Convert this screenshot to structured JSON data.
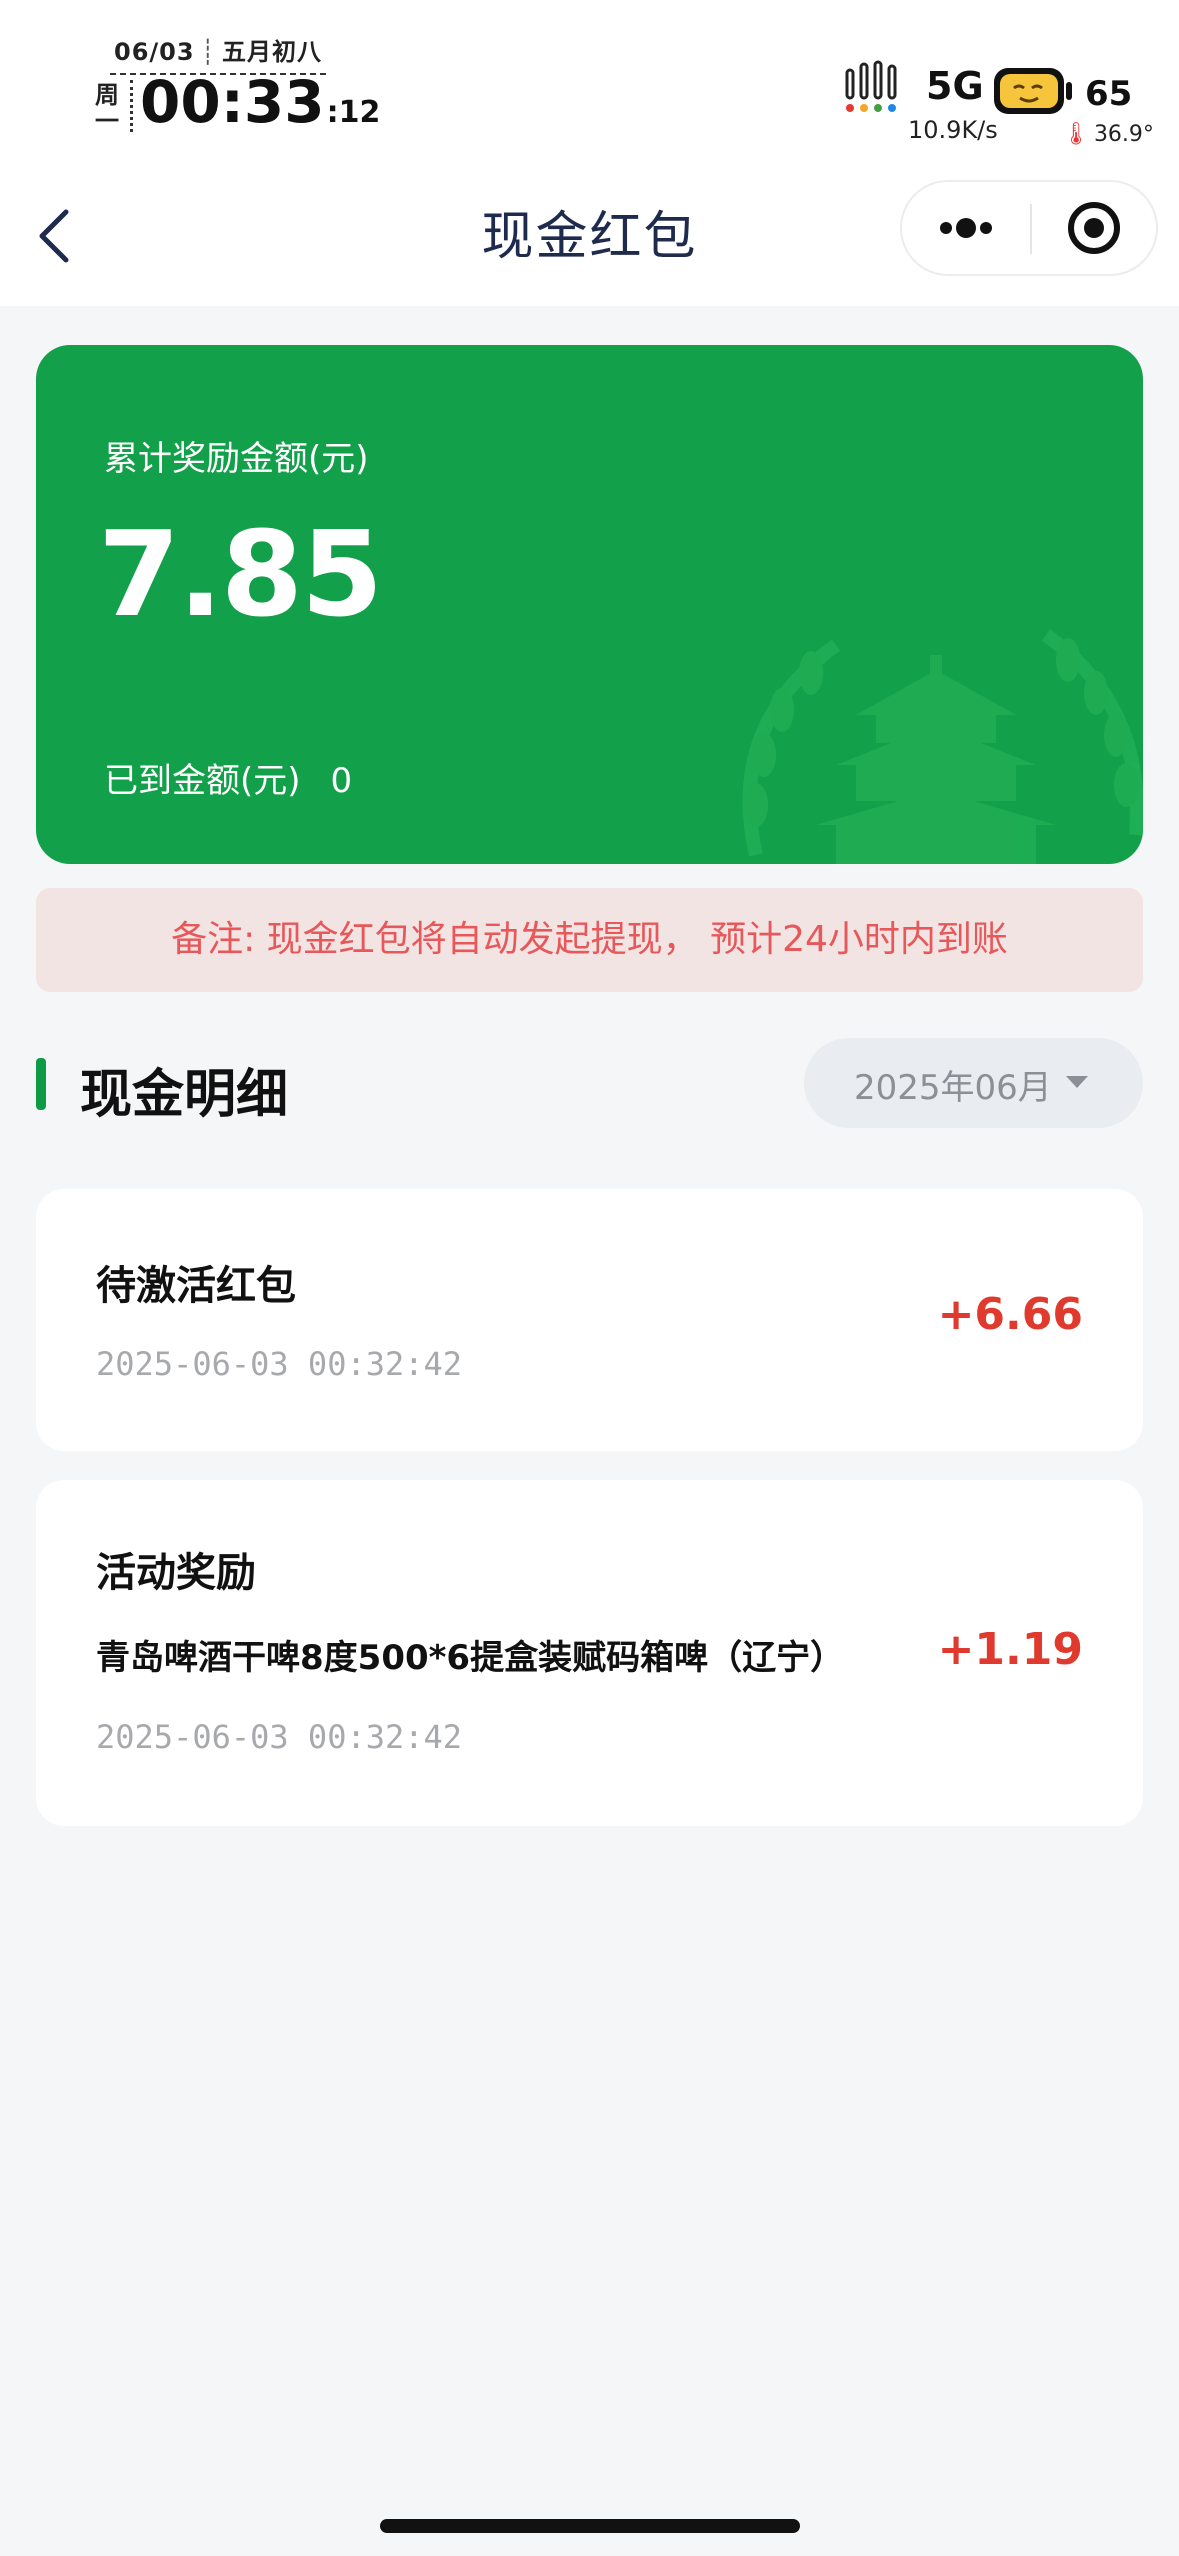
{
  "status_bar": {
    "date": "06/03",
    "lunar": "五月初八",
    "weekday": "周一",
    "time": "00:33",
    "seconds": ":12",
    "network": "5G",
    "speed": "10.9K/s",
    "battery": "65",
    "temperature": "36.9°"
  },
  "nav": {
    "title": "现金红包",
    "back_icon": "chevron-left-icon",
    "more_icon": "more-dots-icon",
    "close_icon": "target-close-icon"
  },
  "summary": {
    "total_label": "累计奖励金额(元)",
    "total_amount": "7.85",
    "arrived_label": "已到金额(元)",
    "arrived_amount": "0",
    "card_color": "#13a04a"
  },
  "notice": {
    "text": "备注: 现金红包将自动发起提现，  预计24小时内到账"
  },
  "detail": {
    "section_title": "现金明细",
    "month": "2025年06月",
    "records": [
      {
        "title": "待激活红包",
        "subtitle": "",
        "time": "2025-06-03 00:32:42",
        "amount": "+6.66"
      },
      {
        "title": "活动奖励",
        "subtitle": "青岛啤酒干啤8度500*6提盒装赋码箱啤（辽宁）",
        "time": "2025-06-03 00:32:42",
        "amount": "+1.19"
      }
    ]
  },
  "colors": {
    "accent_green": "#0f9a47",
    "amount_red": "#e03a2f",
    "notice_text": "#e8575a"
  }
}
